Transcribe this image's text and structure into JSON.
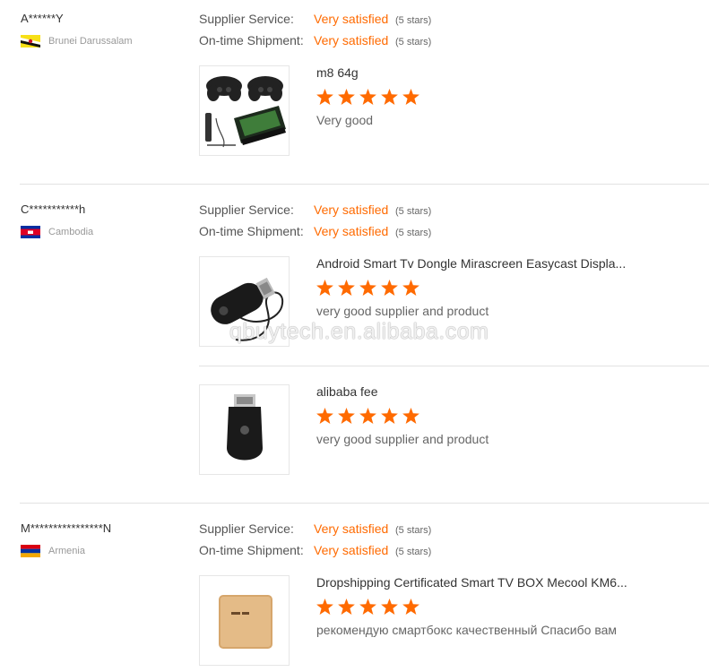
{
  "labels": {
    "supplier_service": "Supplier Service:",
    "ontime_shipment": "On-time Shipment:"
  },
  "reviews": [
    {
      "name": "A******Y",
      "country": "Brunei Darussalam",
      "flag": "brunei-flag",
      "supplier_service": "Very satisfied",
      "supplier_service_stars": "(5 stars)",
      "ontime_shipment": "Very satisfied",
      "ontime_shipment_stars": "(5 stars)",
      "products": [
        {
          "title": "m8 64g",
          "rating": 5,
          "comment": "Very good",
          "image": "game-console-gamepads-image"
        }
      ]
    },
    {
      "name": "C***********h",
      "country": "Cambodia",
      "flag": "cambodia-flag",
      "supplier_service": "Very satisfied",
      "supplier_service_stars": "(5 stars)",
      "ontime_shipment": "Very satisfied",
      "ontime_shipment_stars": "(5 stars)",
      "products": [
        {
          "title": "Android Smart Tv Dongle Mirascreen Easycast Displa...",
          "rating": 5,
          "comment": "very good supplier and product",
          "image": "anycast-dongle-cable-image"
        },
        {
          "title": "alibaba fee",
          "rating": 5,
          "comment": "very good supplier and product",
          "image": "anycast-dongle-image"
        }
      ]
    },
    {
      "name": "M****************N",
      "country": "Armenia",
      "flag": "armenia-flag",
      "supplier_service": "Very satisfied",
      "supplier_service_stars": "(5 stars)",
      "ontime_shipment": "Very satisfied",
      "ontime_shipment_stars": "(5 stars)",
      "products": [
        {
          "title": "Dropshipping Certificated Smart TV BOX Mecool KM6...",
          "rating": 5,
          "comment": "рекомендую смартбокс качественный Спасибо вам",
          "image": "tv-box-image"
        }
      ]
    }
  ],
  "watermark": "qbuytech.en.alibaba.com",
  "colors": {
    "accent": "#ff6a00",
    "star": "#ff6a00",
    "separator": "#e2e2e2"
  }
}
